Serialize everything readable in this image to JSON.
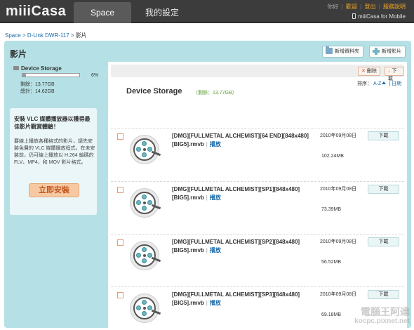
{
  "app": {
    "logo": "miiiCasa"
  },
  "nav": {
    "tab_space": "Space",
    "tab_settings": "我的設定"
  },
  "top_links": {
    "greeting": "你好",
    "welcome": "歡迎",
    "logout": "登出",
    "help": "服務說明",
    "mobile": "miiiCasa for Mobile"
  },
  "breadcrumb": {
    "root": "Space",
    "device": "D-Link DWR-117",
    "current": "影片"
  },
  "page": {
    "title": "影片",
    "new_folder": "新增資料夾",
    "new_video": "新增影片"
  },
  "storage": {
    "name": "Device Storage",
    "usage_percent": 6,
    "percent_label": "6%",
    "remaining": "剩餘：13.77GB",
    "total": "總計：14.62GB"
  },
  "promo": {
    "title": "安裝 VLC 媒體播放器以獲得最佳影片觀賞體驗！",
    "text": "要線上播放各種格式的影片，請先安裝免費的 VLC 媒體播放程式。在未安裝前，仍可線上播放以 H.264 編碼的 FLV、MP4，和 MOV 影片格式。",
    "button": "立即安裝"
  },
  "toolbar": {
    "delete": "刪除",
    "download": "下載"
  },
  "sort": {
    "label": "排序：",
    "az": "A-Z",
    "date": "日期"
  },
  "content": {
    "title": "Device Storage",
    "remaining": "（剩餘：13.77GB）"
  },
  "files": [
    {
      "name": "[DMG][FULLMETAL ALCHEMIST][64 END][848x480][BIG5].rmvb",
      "play": "播放",
      "date": "2010年09月08日",
      "size": "102.24MB",
      "download": "下載"
    },
    {
      "name": "[DMG][FULLMETAL ALCHEMIST][SP1][848x480][BIG5].rmvb",
      "play": "播放",
      "date": "2010年09月08日",
      "size": "73.39MB",
      "download": "下載"
    },
    {
      "name": "[DMG][FULLMETAL ALCHEMIST][SP2][848x480][BIG5].rmvb",
      "play": "播放",
      "date": "2010年09月08日",
      "size": "56.52MB",
      "download": "下載"
    },
    {
      "name": "[DMG][FULLMETAL ALCHEMIST][SP3][848x480][BIG5].rmvb",
      "play": "播放",
      "date": "2010年09月08日",
      "size": "69.18MB",
      "download": "下載"
    }
  ],
  "watermark": {
    "line1": "電腦王阿達",
    "line2": "kocpc.pixnet.net"
  }
}
